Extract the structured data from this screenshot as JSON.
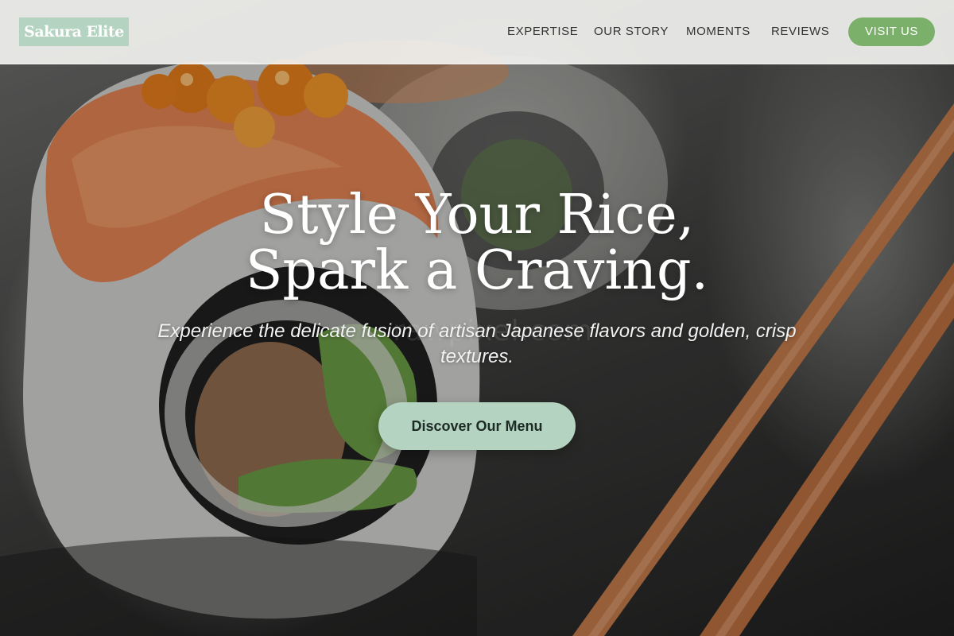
{
  "nav": {
    "logo": "Sakura Elite",
    "items": [
      {
        "label": "EXPERTISE"
      },
      {
        "label": "OUR STORY"
      },
      {
        "label": "MOMENTS"
      },
      {
        "label": "REVIEWS"
      }
    ],
    "visit_label": "VISIT US"
  },
  "hero": {
    "headline_line1": "Style Your Rice,",
    "headline_line2": "Spark a Craving.",
    "subtitle": "Experience the delicate fusion of artisan Japanese flavors and golden, crisp textures.",
    "cta_label": "Discover Our Menu",
    "image_subject": "salmon sushi roll with roe and chopsticks",
    "watermark": "rawpixel.com"
  },
  "colors": {
    "logo_bg": "#b4d4c1",
    "visit_bg": "#7bb06a",
    "cta_bg": "#b4d4c1",
    "nav_bg": "#f5f5f3"
  }
}
